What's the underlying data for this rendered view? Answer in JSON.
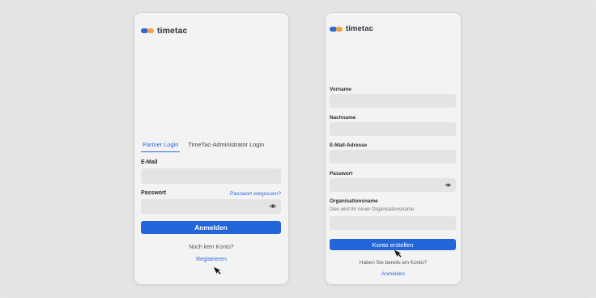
{
  "colors": {
    "accent": "#2266d9",
    "brand_blue": "#2e69d6",
    "brand_orange": "#f4a23a",
    "card": "#f3f3f3",
    "field": "#e4e4e4"
  },
  "left": {
    "brand": "timetac",
    "tabs": [
      {
        "label": "Partner Login",
        "active": true
      },
      {
        "label": "TimeTac-Administrator Login",
        "active": false
      }
    ],
    "email_label": "E-Mail",
    "password_label": "Passwort",
    "forgot_link": "Passwort vergessen?",
    "login_button": "Anmelden",
    "no_account": "Noch kein Konto?",
    "register_link": "Registrieren"
  },
  "right": {
    "brand": "timetac",
    "first_name_label": "Vorname",
    "last_name_label": "Nachname",
    "email_label": "E-Mail-Adresse",
    "password_label": "Passwort",
    "org_label": "Organisationsname",
    "org_hint": "Dies wird Ihr neuer Organisationsname",
    "create_button": "Konto erstellen",
    "have_account": "Haben Sie bereits ein Konto?",
    "login_link": "Anmelden"
  },
  "icons": {
    "eye": "eye-icon",
    "cursor": "mouse-cursor-icon"
  }
}
